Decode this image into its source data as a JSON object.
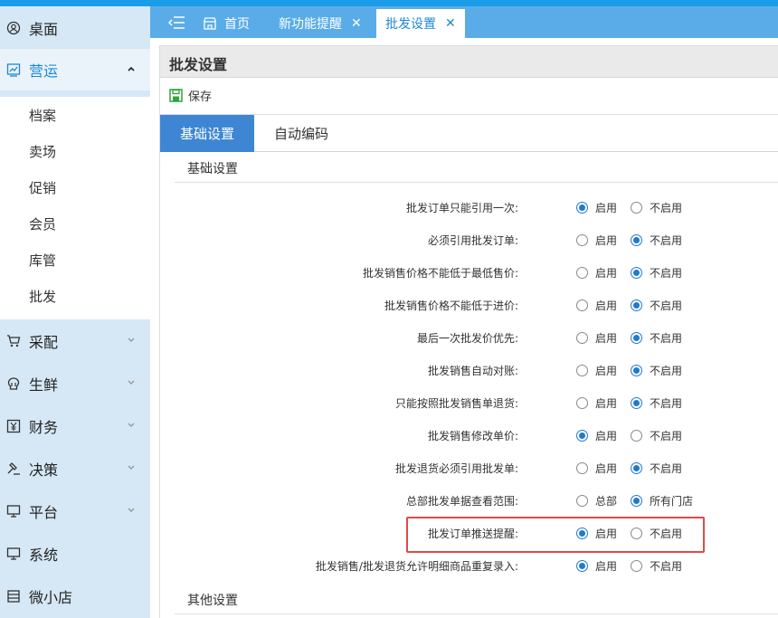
{
  "sidebar": {
    "items": [
      {
        "label": "桌面",
        "icon": "desktop-icon"
      },
      {
        "label": "营运",
        "icon": "operations-icon"
      },
      {
        "label": "采配",
        "icon": "cart-icon"
      },
      {
        "label": "生鲜",
        "icon": "fresh-icon"
      },
      {
        "label": "财务",
        "icon": "finance-icon"
      },
      {
        "label": "决策",
        "icon": "decision-icon"
      },
      {
        "label": "平台",
        "icon": "platform-icon"
      },
      {
        "label": "系统",
        "icon": "system-icon"
      },
      {
        "label": "微小店",
        "icon": "shop-icon"
      }
    ],
    "sub_items": [
      "档案",
      "卖场",
      "促销",
      "会员",
      "库管",
      "批发"
    ],
    "accent": "#1e88d6"
  },
  "tabs": [
    {
      "label": "首页"
    },
    {
      "label": "新功能提醒"
    },
    {
      "label": "批发设置"
    }
  ],
  "page": {
    "title": "批发设置",
    "save_label": "保存",
    "subtabs": [
      "基础设置",
      "自动编码"
    ],
    "section_basic": "基础设置",
    "section_other": "其他设置"
  },
  "settings": [
    {
      "label": "批发订单只能引用一次:",
      "options": [
        "启用",
        "不启用"
      ],
      "selected": 0
    },
    {
      "label": "必须引用批发订单:",
      "options": [
        "启用",
        "不启用"
      ],
      "selected": 1
    },
    {
      "label": "批发销售价格不能低于最低售价:",
      "options": [
        "启用",
        "不启用"
      ],
      "selected": 1
    },
    {
      "label": "批发销售价格不能低于进价:",
      "options": [
        "启用",
        "不启用"
      ],
      "selected": 1
    },
    {
      "label": "最后一次批发价优先:",
      "options": [
        "启用",
        "不启用"
      ],
      "selected": 1
    },
    {
      "label": "批发销售自动对账:",
      "options": [
        "启用",
        "不启用"
      ],
      "selected": 1
    },
    {
      "label": "只能按照批发销售单退货:",
      "options": [
        "启用",
        "不启用"
      ],
      "selected": 1
    },
    {
      "label": "批发销售修改单价:",
      "options": [
        "启用",
        "不启用"
      ],
      "selected": 0
    },
    {
      "label": "批发退货必须引用批发单:",
      "options": [
        "启用",
        "不启用"
      ],
      "selected": 1
    },
    {
      "label": "总部批发单据查看范围:",
      "options": [
        "总部",
        "所有门店"
      ],
      "selected": 1
    },
    {
      "label": "批发订单推送提醒:",
      "options": [
        "启用",
        "不启用"
      ],
      "selected": 0
    },
    {
      "label": "批发销售/批发退货允许明细商品重复录入:",
      "options": [
        "启用",
        "不启用"
      ],
      "selected": 0
    }
  ],
  "colors": {
    "tabbar": "#5aace9",
    "active_subtab": "#3e86d4",
    "highlight": "#e04a4a"
  }
}
